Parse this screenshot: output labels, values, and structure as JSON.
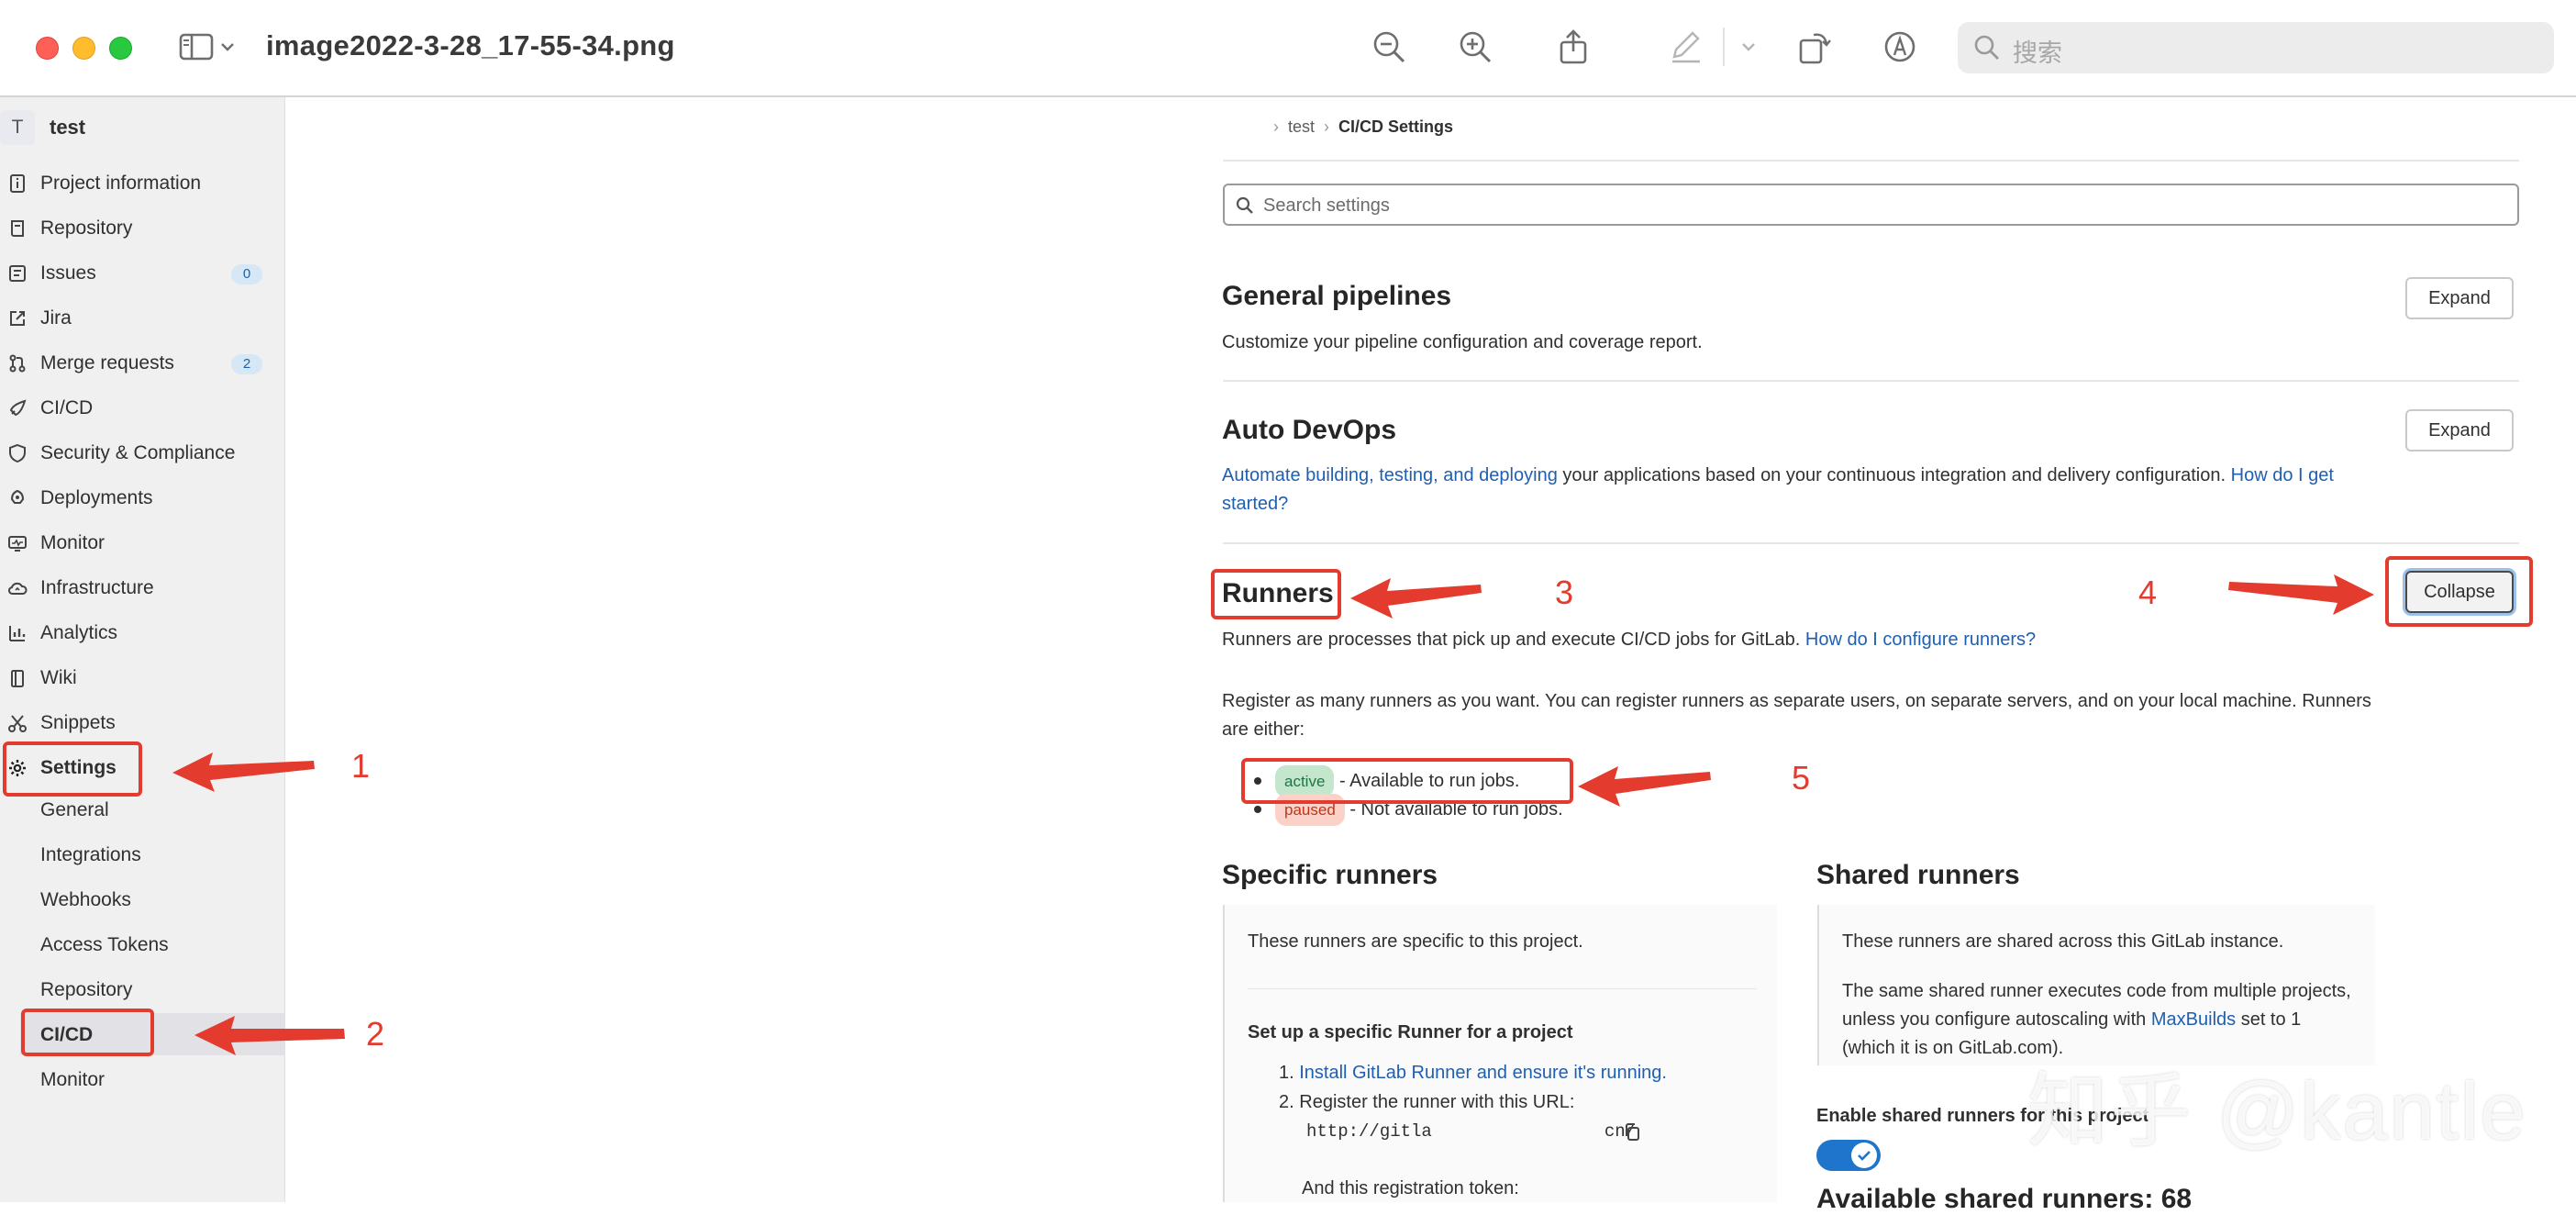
{
  "window": {
    "title": "image2022-3-28_17-55-34.png",
    "search_placeholder": "搜索"
  },
  "toolbar_icons": [
    "sidebar-toggle-icon",
    "chevron-down-icon",
    "zoom-out-icon",
    "zoom-in-icon",
    "share-icon",
    "markup-pen-icon",
    "rotate-icon",
    "markup-toolbar-icon",
    "search-icon"
  ],
  "sidebar": {
    "project_initial": "T",
    "project_name": "test",
    "items": [
      {
        "label": "Project information",
        "icon": "info-doc-icon"
      },
      {
        "label": "Repository",
        "icon": "repository-icon"
      },
      {
        "label": "Issues",
        "icon": "issues-icon",
        "badge": "0"
      },
      {
        "label": "Jira",
        "icon": "external-link-icon"
      },
      {
        "label": "Merge requests",
        "icon": "merge-request-icon",
        "badge": "2"
      },
      {
        "label": "CI/CD",
        "icon": "rocket-icon"
      },
      {
        "label": "Security & Compliance",
        "icon": "shield-icon"
      },
      {
        "label": "Deployments",
        "icon": "deployments-icon"
      },
      {
        "label": "Monitor",
        "icon": "monitor-icon"
      },
      {
        "label": "Infrastructure",
        "icon": "cloud-icon"
      },
      {
        "label": "Analytics",
        "icon": "chart-icon"
      },
      {
        "label": "Wiki",
        "icon": "book-icon"
      },
      {
        "label": "Snippets",
        "icon": "scissors-icon"
      },
      {
        "label": "Settings",
        "icon": "gear-icon"
      }
    ],
    "settings_subitems": [
      "General",
      "Integrations",
      "Webhooks",
      "Access Tokens",
      "Repository",
      "CI/CD",
      "Monitor"
    ]
  },
  "breadcrumb": {
    "project": "test",
    "current": "CI/CD Settings"
  },
  "settings_search": {
    "placeholder": "Search settings"
  },
  "sections": {
    "general_pipelines": {
      "title": "General pipelines",
      "description": "Customize your pipeline configuration and coverage report.",
      "button": "Expand"
    },
    "auto_devops": {
      "title": "Auto DevOps",
      "link1": "Automate building, testing, and deploying",
      "text": " your applications based on your continuous integration and delivery configuration. ",
      "link2": "How do I get started?",
      "button": "Expand"
    },
    "runners": {
      "title": "Runners",
      "button": "Collapse",
      "intro": "Runners are processes that pick up and execute CI/CD jobs for GitLab. ",
      "intro_link": "How do I configure runners?",
      "register_text": "Register as many runners as you want. You can register runners as separate users, on separate servers, and on your local machine. Runners are either:",
      "status_items": [
        {
          "pill": "active",
          "text": " - Available to run jobs."
        },
        {
          "pill": "paused",
          "text": " - Not available to run jobs."
        }
      ]
    },
    "specific_runners": {
      "title": "Specific runners",
      "text": "These runners are specific to this project.",
      "setup_title": "Set up a specific Runner for a project",
      "step1_link": "Install GitLab Runner and ensure it's running.",
      "step2": "Register the runner with this URL:",
      "url_start": "http://gitla",
      "url_end": "cn/",
      "token_label": "And this registration token:"
    },
    "shared_runners": {
      "title": "Shared runners",
      "text": "These runners are shared across this GitLab instance.",
      "text2_before": "The same shared runner executes code from multiple projects, unless you configure autoscaling with ",
      "text2_link": "MaxBuilds",
      "text2_after": " set to 1 (which it is on GitLab.com).",
      "toggle_label": "Enable shared runners for this project",
      "toggle_on": true,
      "available": "Available shared runners: 68"
    }
  },
  "annotations": {
    "numbers": [
      "1",
      "2",
      "3",
      "4",
      "5"
    ],
    "color": "#e33b2e"
  },
  "watermark": "知乎 @kantle"
}
